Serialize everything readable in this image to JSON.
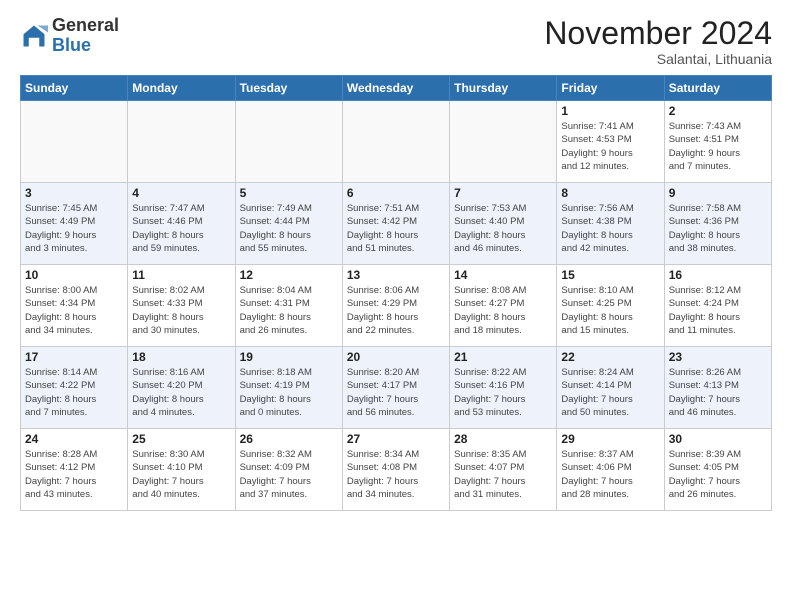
{
  "logo": {
    "general": "General",
    "blue": "Blue"
  },
  "title": "November 2024",
  "location": "Salantai, Lithuania",
  "days_header": [
    "Sunday",
    "Monday",
    "Tuesday",
    "Wednesday",
    "Thursday",
    "Friday",
    "Saturday"
  ],
  "weeks": [
    [
      {
        "day": "",
        "info": ""
      },
      {
        "day": "",
        "info": ""
      },
      {
        "day": "",
        "info": ""
      },
      {
        "day": "",
        "info": ""
      },
      {
        "day": "",
        "info": ""
      },
      {
        "day": "1",
        "info": "Sunrise: 7:41 AM\nSunset: 4:53 PM\nDaylight: 9 hours\nand 12 minutes."
      },
      {
        "day": "2",
        "info": "Sunrise: 7:43 AM\nSunset: 4:51 PM\nDaylight: 9 hours\nand 7 minutes."
      }
    ],
    [
      {
        "day": "3",
        "info": "Sunrise: 7:45 AM\nSunset: 4:49 PM\nDaylight: 9 hours\nand 3 minutes."
      },
      {
        "day": "4",
        "info": "Sunrise: 7:47 AM\nSunset: 4:46 PM\nDaylight: 8 hours\nand 59 minutes."
      },
      {
        "day": "5",
        "info": "Sunrise: 7:49 AM\nSunset: 4:44 PM\nDaylight: 8 hours\nand 55 minutes."
      },
      {
        "day": "6",
        "info": "Sunrise: 7:51 AM\nSunset: 4:42 PM\nDaylight: 8 hours\nand 51 minutes."
      },
      {
        "day": "7",
        "info": "Sunrise: 7:53 AM\nSunset: 4:40 PM\nDaylight: 8 hours\nand 46 minutes."
      },
      {
        "day": "8",
        "info": "Sunrise: 7:56 AM\nSunset: 4:38 PM\nDaylight: 8 hours\nand 42 minutes."
      },
      {
        "day": "9",
        "info": "Sunrise: 7:58 AM\nSunset: 4:36 PM\nDaylight: 8 hours\nand 38 minutes."
      }
    ],
    [
      {
        "day": "10",
        "info": "Sunrise: 8:00 AM\nSunset: 4:34 PM\nDaylight: 8 hours\nand 34 minutes."
      },
      {
        "day": "11",
        "info": "Sunrise: 8:02 AM\nSunset: 4:33 PM\nDaylight: 8 hours\nand 30 minutes."
      },
      {
        "day": "12",
        "info": "Sunrise: 8:04 AM\nSunset: 4:31 PM\nDaylight: 8 hours\nand 26 minutes."
      },
      {
        "day": "13",
        "info": "Sunrise: 8:06 AM\nSunset: 4:29 PM\nDaylight: 8 hours\nand 22 minutes."
      },
      {
        "day": "14",
        "info": "Sunrise: 8:08 AM\nSunset: 4:27 PM\nDaylight: 8 hours\nand 18 minutes."
      },
      {
        "day": "15",
        "info": "Sunrise: 8:10 AM\nSunset: 4:25 PM\nDaylight: 8 hours\nand 15 minutes."
      },
      {
        "day": "16",
        "info": "Sunrise: 8:12 AM\nSunset: 4:24 PM\nDaylight: 8 hours\nand 11 minutes."
      }
    ],
    [
      {
        "day": "17",
        "info": "Sunrise: 8:14 AM\nSunset: 4:22 PM\nDaylight: 8 hours\nand 7 minutes."
      },
      {
        "day": "18",
        "info": "Sunrise: 8:16 AM\nSunset: 4:20 PM\nDaylight: 8 hours\nand 4 minutes."
      },
      {
        "day": "19",
        "info": "Sunrise: 8:18 AM\nSunset: 4:19 PM\nDaylight: 8 hours\nand 0 minutes."
      },
      {
        "day": "20",
        "info": "Sunrise: 8:20 AM\nSunset: 4:17 PM\nDaylight: 7 hours\nand 56 minutes."
      },
      {
        "day": "21",
        "info": "Sunrise: 8:22 AM\nSunset: 4:16 PM\nDaylight: 7 hours\nand 53 minutes."
      },
      {
        "day": "22",
        "info": "Sunrise: 8:24 AM\nSunset: 4:14 PM\nDaylight: 7 hours\nand 50 minutes."
      },
      {
        "day": "23",
        "info": "Sunrise: 8:26 AM\nSunset: 4:13 PM\nDaylight: 7 hours\nand 46 minutes."
      }
    ],
    [
      {
        "day": "24",
        "info": "Sunrise: 8:28 AM\nSunset: 4:12 PM\nDaylight: 7 hours\nand 43 minutes."
      },
      {
        "day": "25",
        "info": "Sunrise: 8:30 AM\nSunset: 4:10 PM\nDaylight: 7 hours\nand 40 minutes."
      },
      {
        "day": "26",
        "info": "Sunrise: 8:32 AM\nSunset: 4:09 PM\nDaylight: 7 hours\nand 37 minutes."
      },
      {
        "day": "27",
        "info": "Sunrise: 8:34 AM\nSunset: 4:08 PM\nDaylight: 7 hours\nand 34 minutes."
      },
      {
        "day": "28",
        "info": "Sunrise: 8:35 AM\nSunset: 4:07 PM\nDaylight: 7 hours\nand 31 minutes."
      },
      {
        "day": "29",
        "info": "Sunrise: 8:37 AM\nSunset: 4:06 PM\nDaylight: 7 hours\nand 28 minutes."
      },
      {
        "day": "30",
        "info": "Sunrise: 8:39 AM\nSunset: 4:05 PM\nDaylight: 7 hours\nand 26 minutes."
      }
    ]
  ]
}
